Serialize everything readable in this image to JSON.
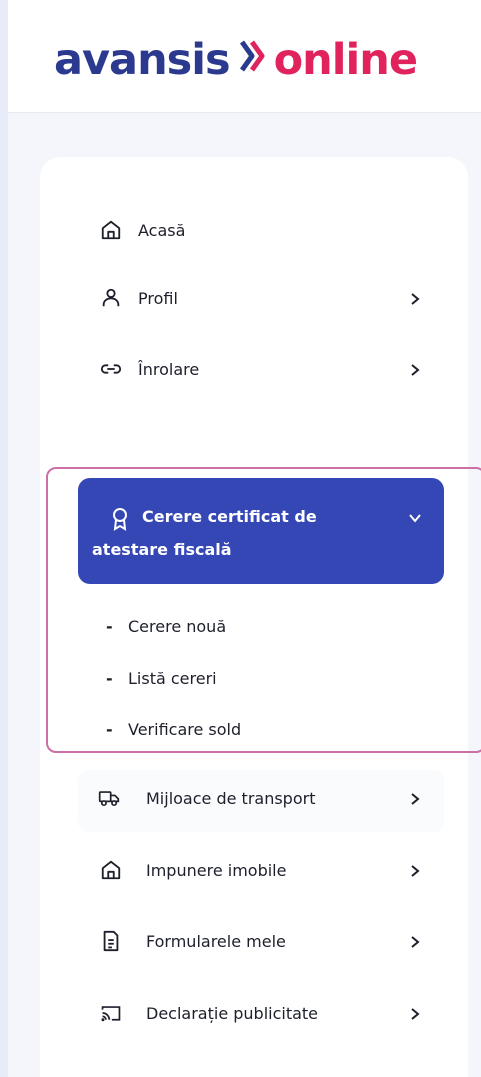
{
  "brand": {
    "part1": "avansis",
    "part2": "online"
  },
  "menu": {
    "home": "Acasă",
    "profile": "Profil",
    "enroll": "Înrolare",
    "certificate_line1": "Cerere certificat de",
    "certificate_line2": "atestare fiscală",
    "sub_new": "Cerere nouă",
    "sub_list": "Listă cereri",
    "sub_balance": "Verificare sold",
    "transport": "Mijloace de transport",
    "property_tax": "Impunere imobile",
    "my_forms": "Formularele mele",
    "ad_declaration": "Declarație publicitate"
  },
  "colors": {
    "brand_blue": "#2b3a8f",
    "brand_pink": "#e0235d",
    "active_bg": "#3547b5",
    "highlight_border": "#cc6fa6"
  },
  "icons": [
    "home-icon",
    "user-icon",
    "link-icon",
    "award-icon",
    "chevron-down-icon",
    "truck-icon",
    "building-icon",
    "document-icon",
    "cast-icon",
    "chevron-right-icon"
  ]
}
